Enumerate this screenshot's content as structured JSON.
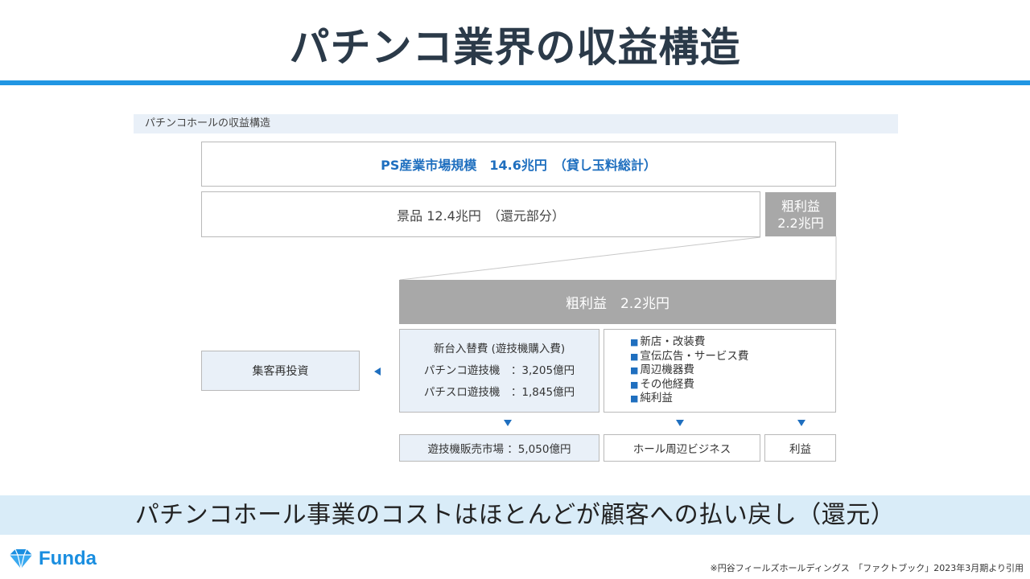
{
  "slide": {
    "title": "パチンコ業界の収益構造",
    "section_label": "パチンコホールの収益構造"
  },
  "diagram": {
    "market": "PS産業市場規模　14.6兆円　（貸し玉料総計）",
    "prizes": "景品 12.4兆円　（還元部分）",
    "gross_small_line1": "粗利益",
    "gross_small_line2": "2.2兆円",
    "gross_big": "粗利益　2.2兆円",
    "reinvest": "集客再投資",
    "new_machine": {
      "heading": "新台入替費 (遊技機購入費)",
      "pachinko": "パチンコ遊技機　：3,205億円",
      "pachislot": "パチスロ遊技機　：1,845億円"
    },
    "costs": [
      "新店・改装費",
      "宣伝広告・サービス費",
      "周辺機器費",
      "その他経費",
      "純利益"
    ],
    "bottom": [
      "遊技機販売市場 ：5,050億円",
      "ホール周辺ビジネス",
      "利益"
    ]
  },
  "summary": "パチンコホール事業のコストはほとんどが顧客への払い戻し（還元）",
  "brand": {
    "logo_text": "Funda",
    "color": "#1a8ee0"
  },
  "footnote": "※円谷フィールズホールディングス　「ファクトブック」2023年3月期より引用",
  "colors": {
    "accent": "#2196e3",
    "market_text": "#1f6fbf",
    "gross_fill": "#a8a8a8",
    "light_fill": "#e9f0f8",
    "summary_band": "#d9ecf8"
  }
}
